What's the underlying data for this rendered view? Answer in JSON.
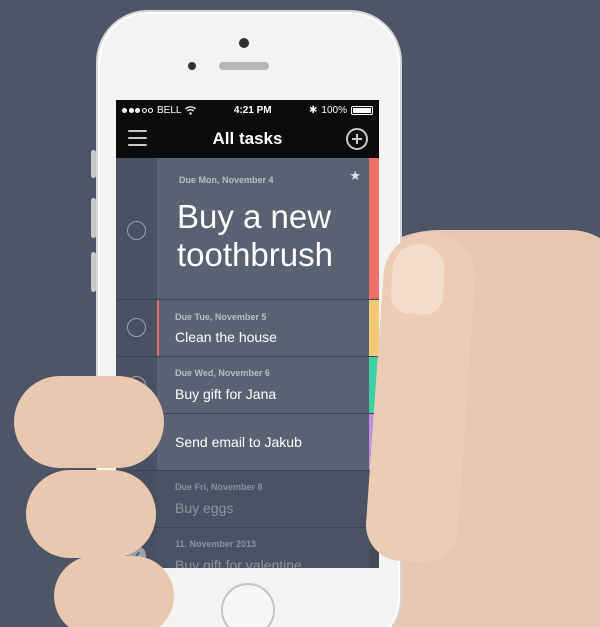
{
  "status_bar": {
    "carrier": "BELL",
    "time": "4:21 PM",
    "battery": "100%"
  },
  "nav": {
    "title": "All tasks"
  },
  "tasks": [
    {
      "due": "Due Mon, November 4",
      "title": "Buy a new toothbrush",
      "color": "#ef6f6c",
      "starred": true,
      "done": false
    },
    {
      "due": "Due Tue, November 5",
      "title": "Clean the house",
      "color": "#f3ca74",
      "done": false
    },
    {
      "due": "Due Wed, November 6",
      "title": "Buy gift for Jana",
      "color": "#3fcfa6",
      "done": false
    },
    {
      "due": "",
      "title": "Send email to Jakub",
      "color": "#c08fe0",
      "done": false
    },
    {
      "due": "Due Fri, November 8",
      "title": "Buy eggs",
      "color": "#454b59",
      "done": true
    },
    {
      "due": "11. November 2013",
      "title": "Buy gift for valentine",
      "color": "#454b59",
      "done": true
    }
  ],
  "icons": {
    "menu": "hamburger-icon",
    "add": "plus-circle-icon",
    "star": "star-icon",
    "check": "check-icon",
    "wifi": "wifi-icon",
    "bluetooth": "bluetooth-icon",
    "battery": "battery-icon"
  },
  "colors": {
    "background": "#4e5566",
    "screen": "#4b5363",
    "navbar": "#0b0b0b"
  }
}
